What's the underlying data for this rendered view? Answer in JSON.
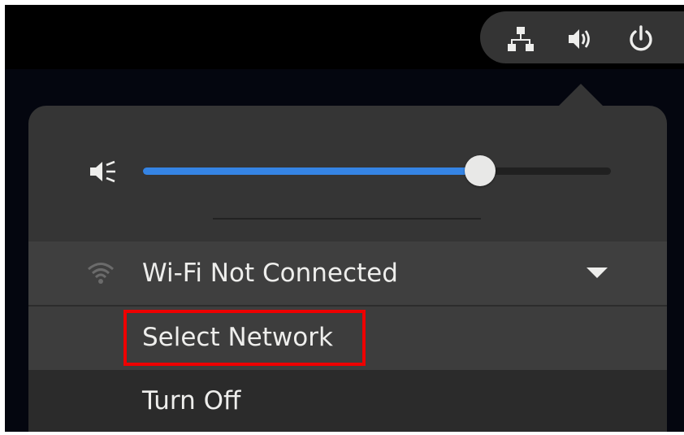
{
  "top_bar": {
    "indicators": [
      {
        "icon": "network-wired-icon"
      },
      {
        "icon": "volume-high-icon"
      },
      {
        "icon": "power-icon"
      }
    ]
  },
  "volume": {
    "icon": "volume-muted-icon",
    "level": 0.72
  },
  "wifi": {
    "icon": "wifi-icon",
    "label": "Wi-Fi Not Connected",
    "expanded": true,
    "items": [
      {
        "label": "Select Network"
      },
      {
        "label": "Turn Off"
      }
    ]
  },
  "colors": {
    "accent": "#3584e4",
    "highlight": "#ee0000",
    "panel": "#353535"
  }
}
